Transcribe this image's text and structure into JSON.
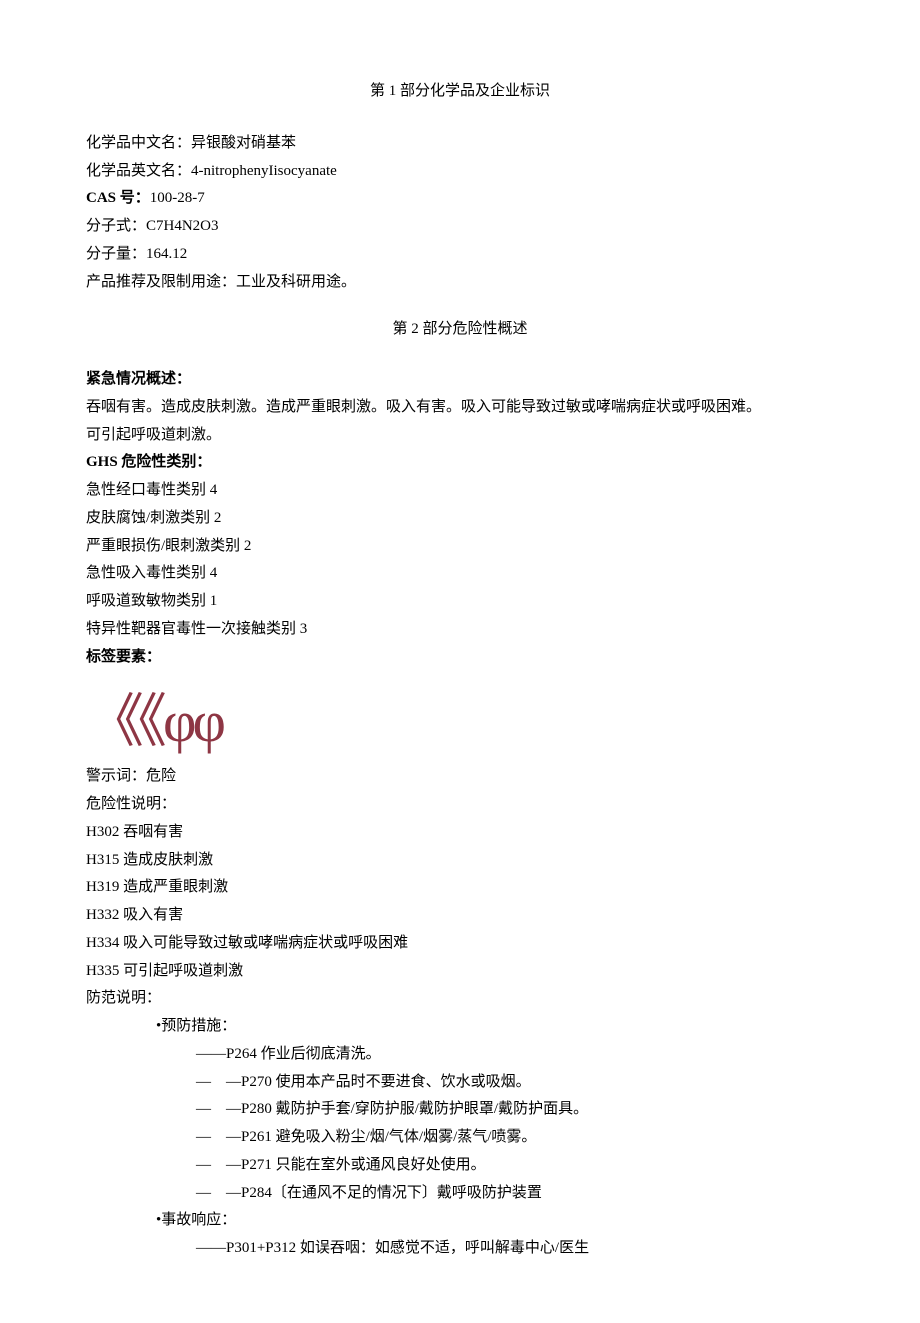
{
  "section1": {
    "title": "第 1 部分化学品及企业标识",
    "fields": {
      "cn_name_label": "化学品中文名：",
      "cn_name_value": "异银酸对硝基苯",
      "en_name_label": "化学品英文名：",
      "en_name_value": "4-nitrophenyIisocyanate",
      "cas_label": "CAS 号：",
      "cas_value": "100-28-7",
      "formula_label": "分子式：",
      "formula_value": "C7H4N2O3",
      "mw_label": "分子量：",
      "mw_value": "164.12",
      "use_label": "产品推荐及限制用途：",
      "use_value": "工业及科研用途。"
    }
  },
  "section2": {
    "title": "第 2 部分危险性概述",
    "emergency_header": "紧急情况概述：",
    "emergency_line1": "吞咽有害。造成皮肤刺激。造成严重眼刺激。吸入有害。吸入可能导致过敏或哮喘病症状或呼吸困难。",
    "emergency_line2": "可引起呼吸道刺激。",
    "ghs_header": "GHS 危险性类别：",
    "ghs_items": [
      "急性经口毒性类别 4",
      "皮肤腐蚀/刺激类别 2",
      "严重眼损伤/眼刺激类别 2",
      "急性吸入毒性类别 4",
      "呼吸道致敏物类别 1",
      "特异性靶器官毒性一次接触类别 3"
    ],
    "label_elements_header": "标签要素：",
    "pictograms": {
      "left": "《《",
      "phi": "φφ"
    },
    "signal_word_label": "警示词：",
    "signal_word_value": "危险",
    "hazard_header": "危险性说明：",
    "hazard_statements": [
      "H302 吞咽有害",
      "H315 造成皮肤刺激",
      "H319 造成严重眼刺激",
      "H332 吸入有害",
      "H334 吸入可能导致过敏或哮喘病症状或呼吸困难",
      "H335 可引起呼吸道刺激"
    ],
    "precaution_header": "防范说明：",
    "prevention_header": "•预防措施：",
    "prevention_items": [
      "——P264 作业后彻底清洗。",
      "— —P270 使用本产品时不要进食、饮水或吸烟。",
      "— —P280 戴防护手套/穿防护服/戴防护眼罩/戴防护面具。",
      "— —P261 避免吸入粉尘/烟/气体/烟雾/蒸气/喷雾。",
      "— —P271 只能在室外或通风良好处使用。",
      "— —P284〔在通风不足的情况下〕戴呼吸防护装置"
    ],
    "response_header": "•事故响应：",
    "response_items": [
      "——P301+P312 如误吞咽：如感觉不适，呼叫解毒中心/医生"
    ]
  }
}
